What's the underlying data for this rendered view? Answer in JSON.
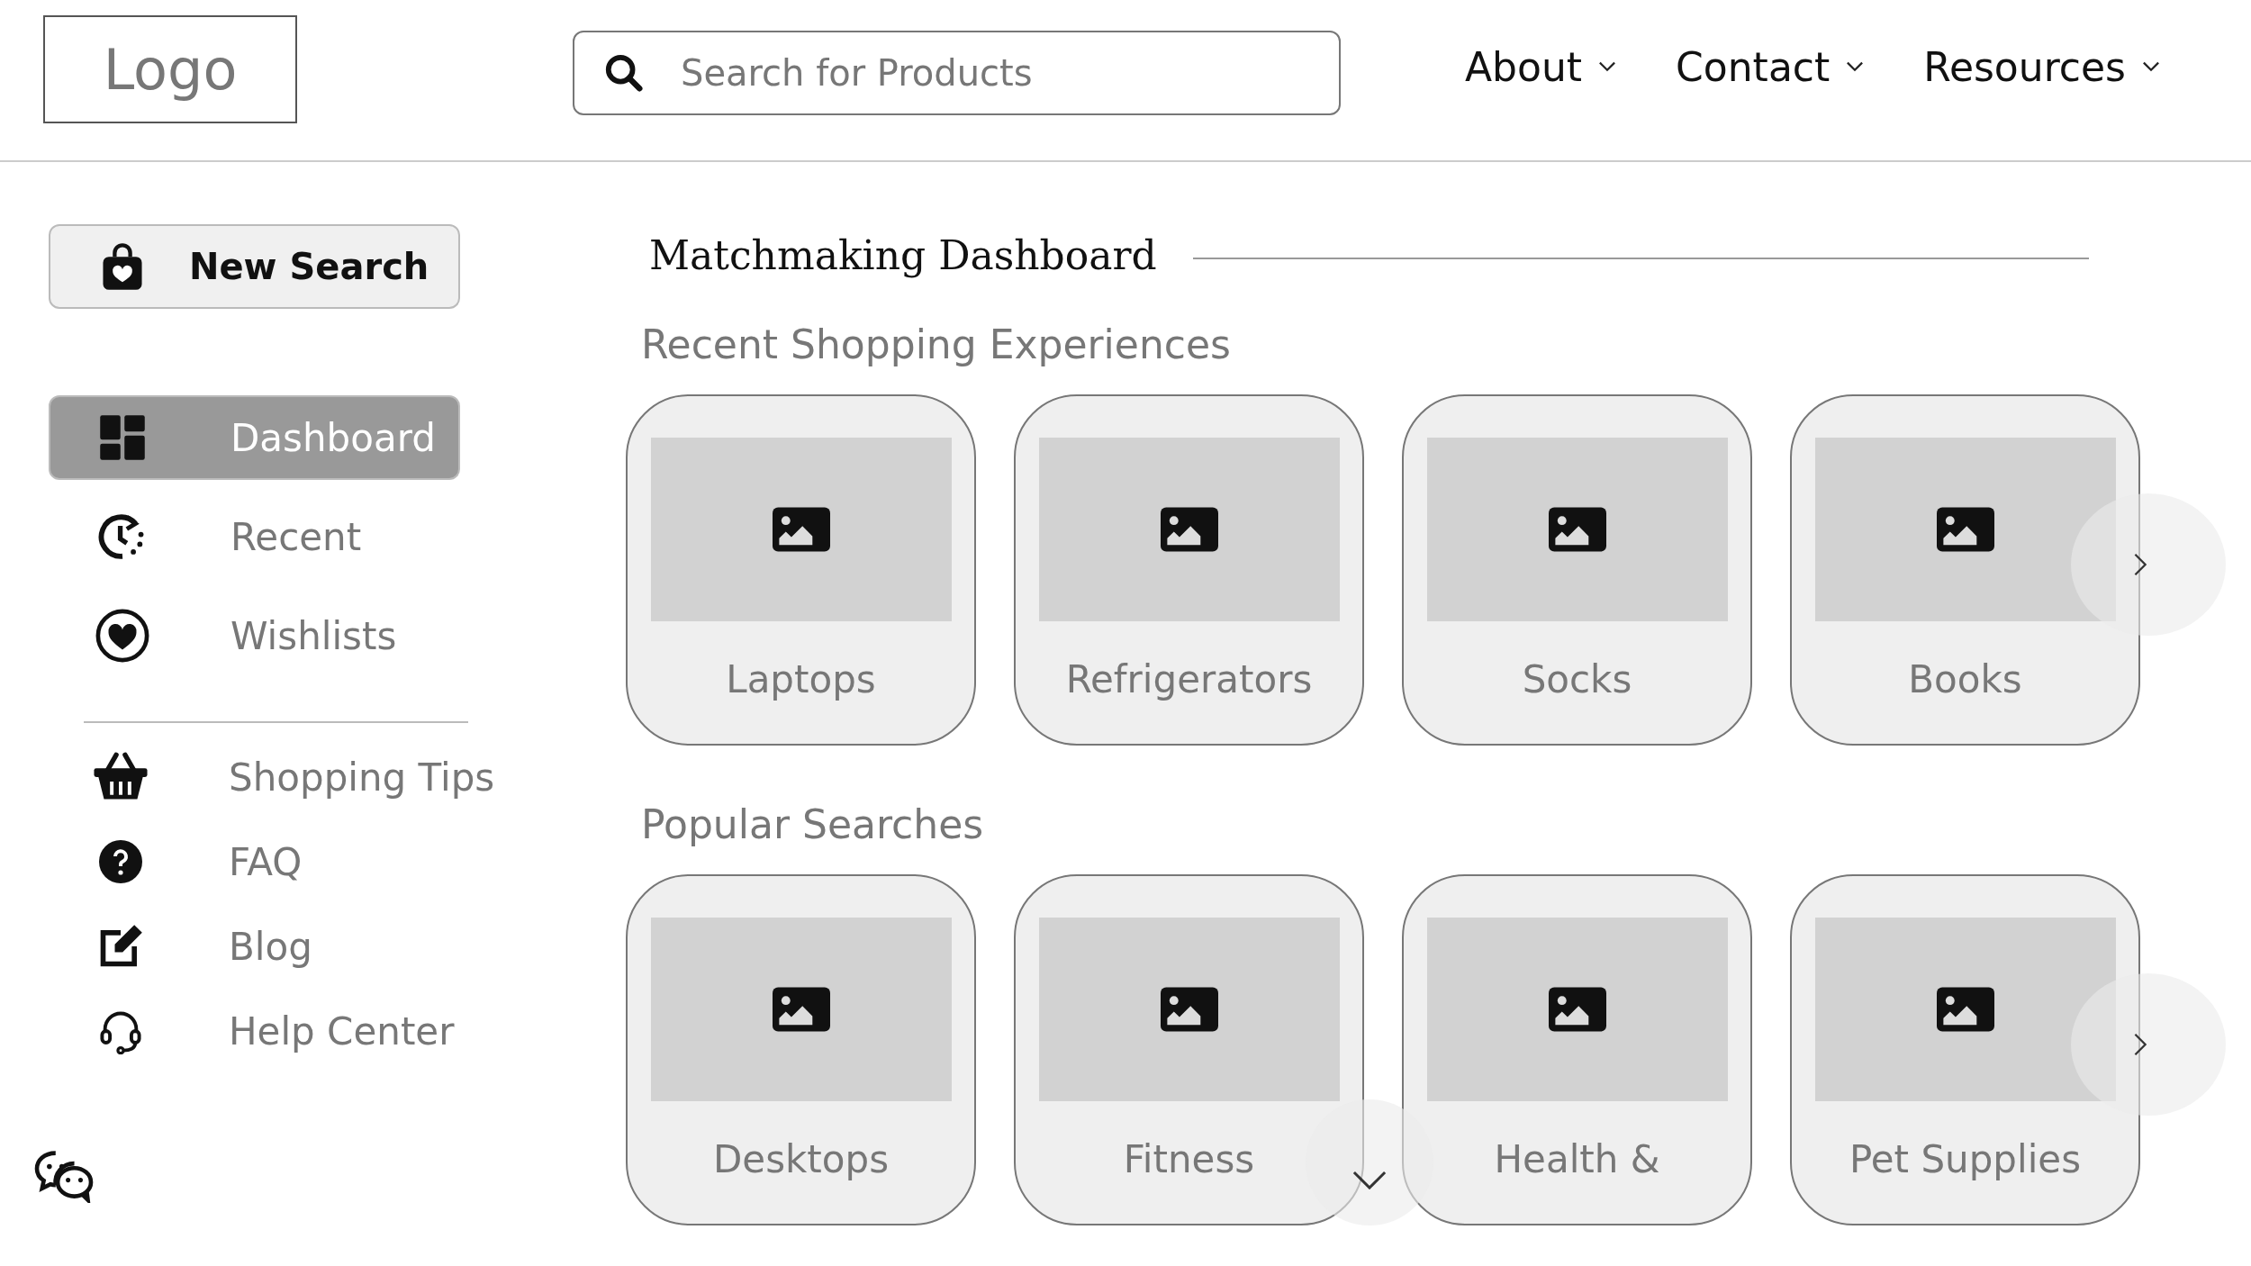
{
  "header": {
    "logo": "Logo",
    "search": {
      "placeholder": "Search for Products"
    },
    "nav": [
      {
        "label": "About"
      },
      {
        "label": "Contact"
      },
      {
        "label": "Resources"
      }
    ]
  },
  "sidebar": {
    "new_search": "New Search",
    "items": [
      {
        "label": "Dashboard",
        "selected": true
      },
      {
        "label": "Recent",
        "selected": false
      },
      {
        "label": "Wishlists",
        "selected": false
      }
    ],
    "links": [
      {
        "label": "Shopping Tips"
      },
      {
        "label": "FAQ"
      },
      {
        "label": "Blog"
      },
      {
        "label": "Help Center"
      }
    ]
  },
  "main": {
    "title": "Matchmaking Dashboard",
    "sections": [
      {
        "heading": "Recent Shopping Experiences",
        "cards": [
          {
            "label": "Laptops"
          },
          {
            "label": "Refrigerators"
          },
          {
            "label": "Socks"
          },
          {
            "label": "Books"
          }
        ]
      },
      {
        "heading": "Popular Searches",
        "cards": [
          {
            "label": "Desktops"
          },
          {
            "label": "Fitness"
          },
          {
            "label": "Health &"
          },
          {
            "label": "Pet Supplies"
          }
        ]
      }
    ]
  }
}
